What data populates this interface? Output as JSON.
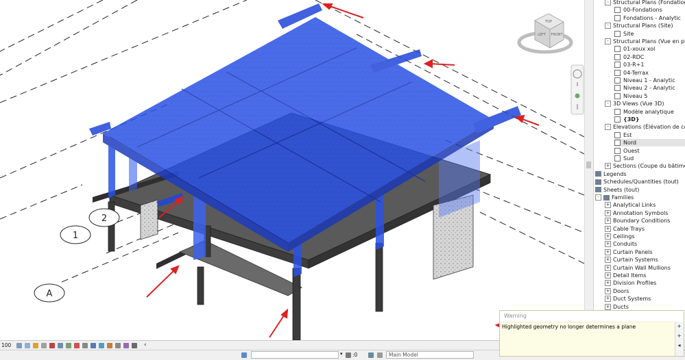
{
  "viewcube": {
    "top": "TOP",
    "left": "LEFT",
    "front": "FRONT"
  },
  "grid_labels": {
    "a": "A",
    "one": "1",
    "two": "2"
  },
  "project_browser": {
    "items": [
      {
        "label": "Structural Plans (Fondations)",
        "level": 1,
        "expander": "-"
      },
      {
        "label": "00-Fondations",
        "level": 2
      },
      {
        "label": "Fondations - Analytic",
        "level": 2
      },
      {
        "label": "Structural Plans (Site)",
        "level": 1,
        "expander": "-"
      },
      {
        "label": "Site",
        "level": 2
      },
      {
        "label": "Structural Plans (Vue en plan)",
        "level": 1,
        "expander": "-"
      },
      {
        "label": "01-xoux xol",
        "level": 2
      },
      {
        "label": "02-RDC",
        "level": 2
      },
      {
        "label": "03-R+1",
        "level": 2
      },
      {
        "label": "04-Terrax",
        "level": 2
      },
      {
        "label": "Niveau 1 - Analytic",
        "level": 2
      },
      {
        "label": "Niveau 2 - Analytic",
        "level": 2
      },
      {
        "label": "Niveau 5",
        "level": 2
      },
      {
        "label": "3D Views (Vue 3D)",
        "level": 1,
        "expander": "-"
      },
      {
        "label": "Modèle analytique",
        "level": 2
      },
      {
        "label": "{3D}",
        "level": 2,
        "bold": true
      },
      {
        "label": "Elevations (Élévation de con",
        "level": 1,
        "expander": "-"
      },
      {
        "label": "Est",
        "level": 2
      },
      {
        "label": "Nord",
        "level": 2,
        "selected": true
      },
      {
        "label": "Ouest",
        "level": 2
      },
      {
        "label": "Sud",
        "level": 2
      },
      {
        "label": "Sections (Coupe du bâtimen",
        "level": 1,
        "expander": "+"
      },
      {
        "label": "Legends",
        "level": 0,
        "icon": "legend"
      },
      {
        "label": "Schedules/Quantities (tout)",
        "level": 0,
        "icon": "schedule"
      },
      {
        "label": "Sheets (tout)",
        "level": 0,
        "icon": "sheet"
      },
      {
        "label": "Families",
        "level": 0,
        "expander": "-",
        "icon": "families"
      },
      {
        "label": "Analytical Links",
        "level": 1,
        "expander": "+"
      },
      {
        "label": "Annotation Symbols",
        "level": 1,
        "expander": "+"
      },
      {
        "label": "Boundary Conditions",
        "level": 1,
        "expander": "+"
      },
      {
        "label": "Cable Trays",
        "level": 1,
        "expander": "+"
      },
      {
        "label": "Ceilings",
        "level": 1,
        "expander": "+"
      },
      {
        "label": "Conduits",
        "level": 1,
        "expander": "+"
      },
      {
        "label": "Curtain Panels",
        "level": 1,
        "expander": "+"
      },
      {
        "label": "Curtain Systems",
        "level": 1,
        "expander": "+"
      },
      {
        "label": "Curtain Wall Mullions",
        "level": 1,
        "expander": "+"
      },
      {
        "label": "Detail Items",
        "level": 1,
        "expander": "+"
      },
      {
        "label": "Division Profiles",
        "level": 1,
        "expander": "+"
      },
      {
        "label": "Doors",
        "level": 1,
        "expander": "+"
      },
      {
        "label": "Duct Systems",
        "level": 1,
        "expander": "+"
      },
      {
        "label": "Ducts",
        "level": 1,
        "expander": "+"
      }
    ]
  },
  "statusbar": {
    "scale": "100"
  },
  "bottombar": {
    "workset_value": "",
    "count": ":0",
    "model": "Main Model"
  },
  "warning": {
    "title": "Warning",
    "message": "Highlighted geometry no longer determines a plane",
    "btn_next": "+",
    "btn_prev": "+",
    "btn_expand": "◂"
  },
  "colors": {
    "highlight": "#2a52e6",
    "arrow": "#e02020",
    "concrete": "#4a4a4a"
  }
}
